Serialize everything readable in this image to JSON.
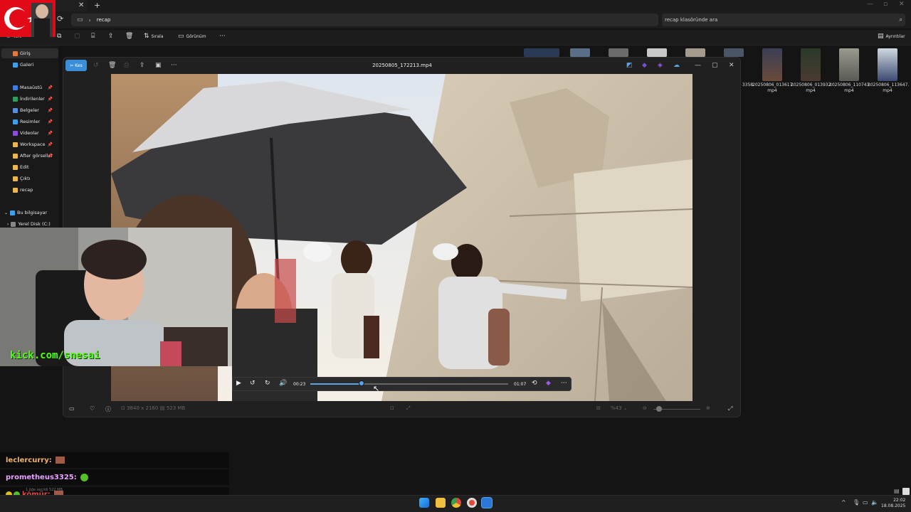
{
  "explorer": {
    "address_path": "recap",
    "search_placeholder": "recap klasöründe ara",
    "commands": {
      "new": "Yeni",
      "sort": "Sırala",
      "view": "Görünüm",
      "details": "Ayrıntılar"
    },
    "sidebar": {
      "home": "Giriş",
      "gallery": "Galeri",
      "items": [
        {
          "label": "Masaüstü",
          "icon": "desktop-icon",
          "color": "#3d7be0"
        },
        {
          "label": "İndirilenler",
          "icon": "download-icon",
          "color": "#2e9c5a"
        },
        {
          "label": "Belgeler",
          "icon": "documents-icon",
          "color": "#5a8de0"
        },
        {
          "label": "Resimler",
          "icon": "pictures-icon",
          "color": "#3fa0e6"
        },
        {
          "label": "Videolar",
          "icon": "videos-icon",
          "color": "#8a4ed8"
        },
        {
          "label": "Workspace",
          "icon": "folder-icon",
          "color": "#e8b84a"
        },
        {
          "label": "After görseller",
          "icon": "folder-icon",
          "color": "#e8b84a"
        },
        {
          "label": "Edit",
          "icon": "folder-icon",
          "color": "#e8b84a"
        },
        {
          "label": "Çıktı",
          "icon": "folder-icon",
          "color": "#e8b84a"
        },
        {
          "label": "recap",
          "icon": "folder-icon",
          "color": "#e8b84a"
        }
      ],
      "this_pc": "Bu bilgisayar",
      "local_disk": "Yerel Disk (C:)"
    },
    "thumbnails": [
      {
        "line1": "3358.",
        "line2": ""
      },
      {
        "line1": "20250806_013617.",
        "line2": "mp4"
      },
      {
        "line1": "20250806_013932.",
        "line2": "mp4"
      },
      {
        "line1": "20250806_110743.",
        "line2": "mp4"
      },
      {
        "line1": "20250806_113647.",
        "line2": "mp4"
      }
    ],
    "status": {
      "selected": "1 öğe seçildi  522 MB"
    }
  },
  "photos": {
    "edit_label": "Kes",
    "title": "20250805_172213.mp4",
    "resolution": "3840 x 2160",
    "size": "523 MB",
    "zoom": "%43",
    "player": {
      "current": "00:23",
      "duration": "01:07",
      "progress": 0.26
    }
  },
  "stream": {
    "kick_url": "kick.com/snesai",
    "chat": [
      {
        "user": "leclercurry:",
        "color": "#f0b36a"
      },
      {
        "user": "prometheus3325:",
        "color": "#e6a2ff"
      },
      {
        "user": "kömür:",
        "color": "#e04545"
      }
    ]
  },
  "taskbar": {
    "time": "22:02",
    "date": "18.08.2025"
  }
}
